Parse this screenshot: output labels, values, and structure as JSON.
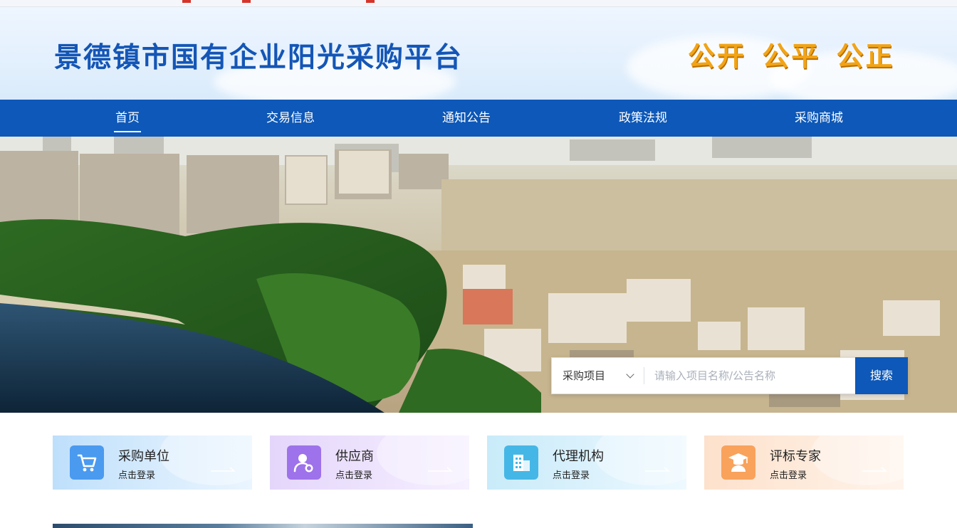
{
  "header": {
    "site_title": "景德镇市国有企业阳光采购平台",
    "slogan": "公开 公平 公正"
  },
  "nav": {
    "items": [
      {
        "label": "首页",
        "active": true
      },
      {
        "label": "交易信息",
        "active": false
      },
      {
        "label": "通知公告",
        "active": false
      },
      {
        "label": "政策法规",
        "active": false
      },
      {
        "label": "采购商城",
        "active": false
      }
    ]
  },
  "search": {
    "category": "采购项目",
    "placeholder": "请输入项目名称/公告名称",
    "button_label": "搜索"
  },
  "roles": [
    {
      "title": "采购单位",
      "subtitle": "点击登录",
      "icon": "cart-icon",
      "color": "#4a9af0"
    },
    {
      "title": "供应商",
      "subtitle": "点击登录",
      "icon": "supplier-user-icon",
      "color": "#9e72ea"
    },
    {
      "title": "代理机构",
      "subtitle": "点击登录",
      "icon": "building-icon",
      "color": "#45b7e6"
    },
    {
      "title": "评标专家",
      "subtitle": "点击登录",
      "icon": "graduate-cap-icon",
      "color": "#f9a25b"
    }
  ],
  "colors": {
    "brand_blue": "#0d58b8",
    "title_blue": "#1456b6",
    "slogan_gold": "#f2a416"
  }
}
